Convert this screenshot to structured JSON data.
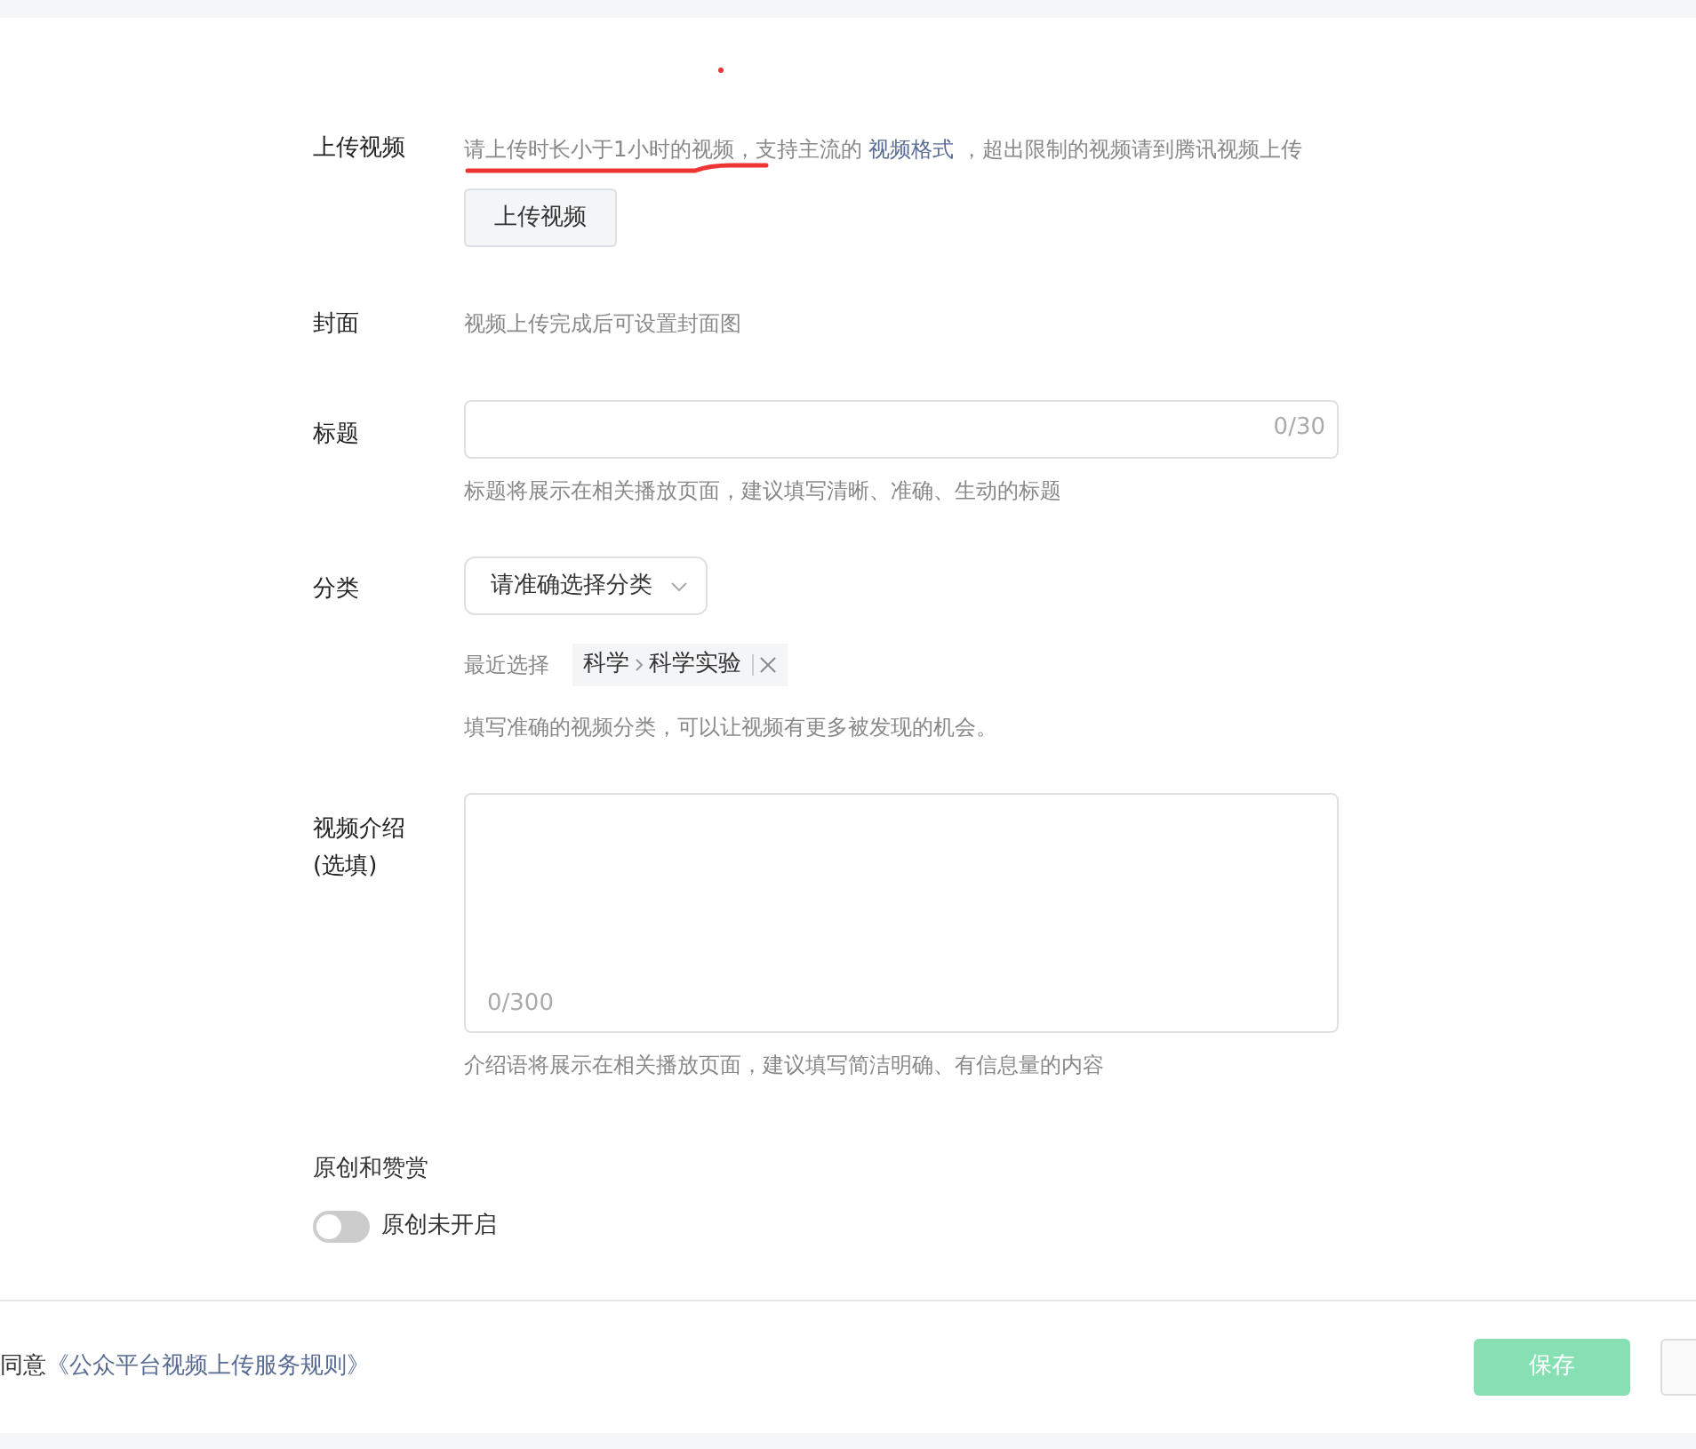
{
  "upload": {
    "label": "上传视频",
    "hint_before": "请上传时长小于1小时的视频，支持主流的 ",
    "hint_link": "视频格式",
    "hint_after": " ，超出限制的视频请到腾讯视频上传",
    "button": "上传视频"
  },
  "cover": {
    "label": "封面",
    "text": "视频上传完成后可设置封面图"
  },
  "title": {
    "label": "标题",
    "counter": "0/30",
    "hint": "标题将展示在相关播放页面，建议填写清晰、准确、生动的标题"
  },
  "category": {
    "label": "分类",
    "placeholder": "请准确选择分类",
    "recent_label": "最近选择",
    "recent_path": [
      "科学",
      "科学实验"
    ],
    "hint": "填写准确的视频分类，可以让视频有更多被发现的机会。"
  },
  "intro": {
    "label": "视频介绍",
    "sublabel": "(选填)",
    "counter": "0/300",
    "hint": "介绍语将展示在相关播放页面，建议填写简洁明确、有信息量的内容"
  },
  "original": {
    "heading": "原创和赞赏",
    "toggle_on": false,
    "toggle_label": "原创未开启"
  },
  "footer": {
    "agree_prefix": "同意",
    "agree_link": "《公众平台视频上传服务规则》",
    "save": {
      "label": "保存",
      "disabled": true
    }
  }
}
